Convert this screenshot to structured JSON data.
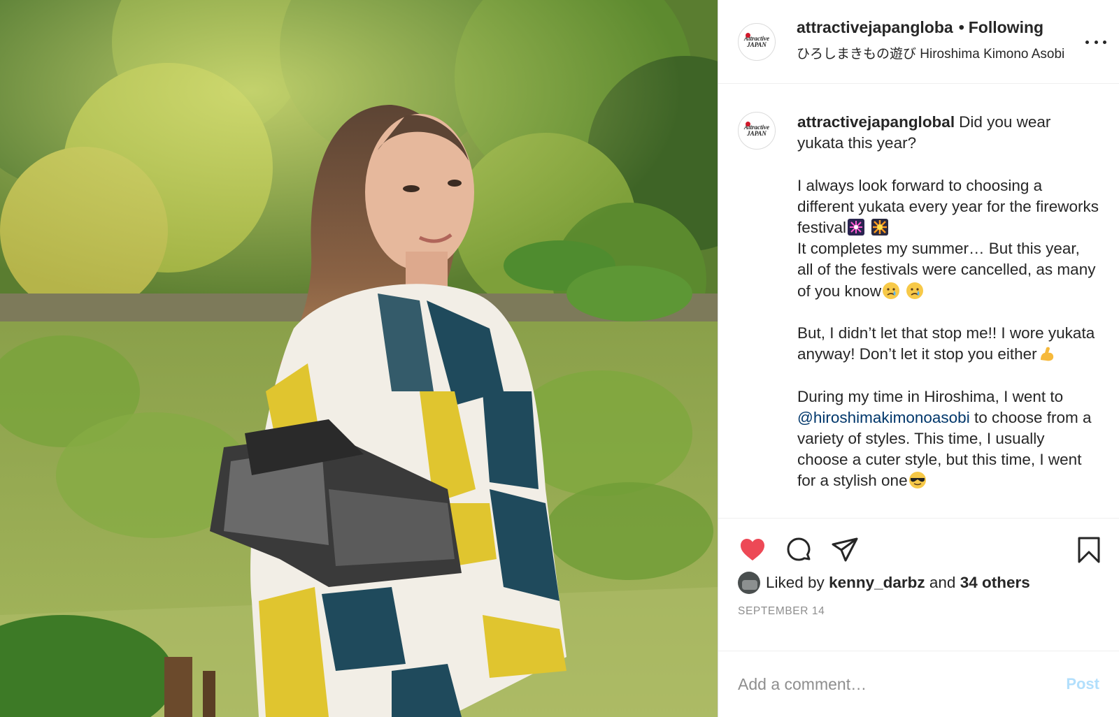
{
  "post": {
    "username": "attractivejapangloba",
    "follow_separator": "•",
    "follow_status": "Following",
    "location": "ひろしまきもの遊び Hiroshima Kimono Asobi",
    "avatar_logo_line1": "Attractive",
    "avatar_logo_line2": "JAPAN"
  },
  "caption": {
    "username": "attractivejapanglobal",
    "paragraphs": {
      "p1": "Did you wear yukata this year?",
      "p2a": "I always look forward to choosing a different yukata every year for the fireworks festival",
      "p2b": "It completes my summer… But this year, all of the festivals were cancelled, as many of you know",
      "p3": "But, I didn’t let that stop me!! I wore yukata anyway! Don’t let it stop you either",
      "p4a": "During my time in Hiroshima, I went to",
      "mention": "@hiroshimakimonoasobi",
      "p4b": "to choose from a variety of styles. This time, I usually choose a cuter style, but this time, I went for a stylish one"
    },
    "emojis": [
      "fireworks-emoji",
      "firework-burst-emoji",
      "crying-face-emoji",
      "crying-face-emoji",
      "flexed-biceps-emoji",
      "sunglasses-face-emoji"
    ]
  },
  "actions": {
    "like_icon": "heart-icon-filled",
    "comment_icon": "comment-icon",
    "share_icon": "paper-plane-icon",
    "save_icon": "bookmark-icon",
    "like_color": "#ed4956"
  },
  "likes": {
    "prefix": "Liked by",
    "liker": "kenny_darbz",
    "joiner": "and",
    "others": "34 others"
  },
  "date": "SEPTEMBER 14",
  "comment": {
    "placeholder": "Add a comment…",
    "post_label": "Post"
  },
  "colors": {
    "mention": "#00376b",
    "post_disabled": "#b2dffc",
    "muted": "#8e8e8e"
  }
}
